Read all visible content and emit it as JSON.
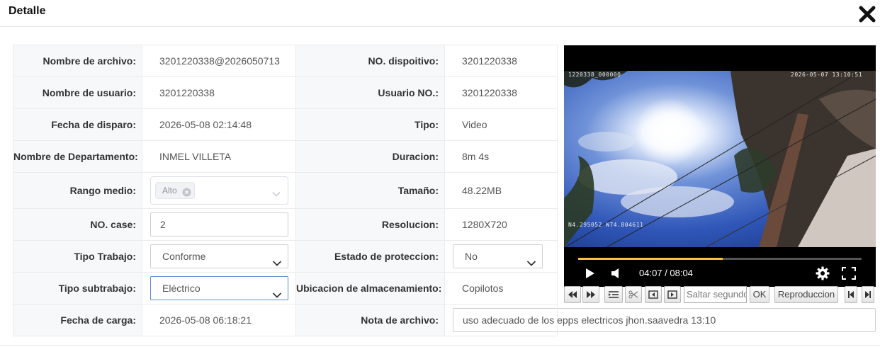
{
  "dialog": {
    "title": "Detalle",
    "close_icon": "close-x-icon"
  },
  "fields": {
    "file_name": {
      "label": "Nombre de archivo:",
      "value": "3201220338@2026050713"
    },
    "device_no": {
      "label": "NO. dispoitivo:",
      "value": "3201220338"
    },
    "user_name": {
      "label": "Nombre de usuario:",
      "value": "3201220338"
    },
    "user_no": {
      "label": "Usuario NO.:",
      "value": "3201220338"
    },
    "trigger_date": {
      "label": "Fecha de disparo:",
      "value": "2026-05-08 02:14:48"
    },
    "type": {
      "label": "Tipo:",
      "value": "Video"
    },
    "department": {
      "label": "Nombre de Departamento:",
      "value": "INMEL VILLETA"
    },
    "duration": {
      "label": "Duracion:",
      "value": "8m 4s"
    },
    "range": {
      "label": "Rango medio:",
      "tag": "Alto"
    },
    "size": {
      "label": "Tamaño:",
      "value": "48.22MB"
    },
    "case_no": {
      "label": "NO. case:",
      "value": "2"
    },
    "resolution": {
      "label": "Resolucion:",
      "value": "1280X720"
    },
    "work_type": {
      "label": "Tipo Trabajo:",
      "value": "Conforme"
    },
    "protection": {
      "label": "Estado de proteccion:",
      "value": "No"
    },
    "subwork_type": {
      "label": "Tipo subtrabajo:",
      "value": "Eléctrico"
    },
    "storage": {
      "label": "Ubicacion de almacenamiento:",
      "value": "Copilotos"
    },
    "upload_date": {
      "label": "Fecha de carga:",
      "value": "2026-05-08 06:18:21"
    },
    "note": {
      "label": "Nota de archivo:",
      "value": "uso adecuado de los epps electricos jhon.saavedra 13:10"
    }
  },
  "player": {
    "osd_top_left": "1220338_000000",
    "osd_top_right": "2026-05-07  13:10:51",
    "osd_gps": "N4.295052  W74.804611",
    "time": "04:07 / 08:04",
    "progress_fraction": 0.51,
    "colors": {
      "progress": "#f5c23a",
      "background": "#000000"
    }
  },
  "toolbar": {
    "seek_placeholder": "Saltar segundo",
    "ok_label": "OK",
    "playback_label": "Reproduccion"
  }
}
